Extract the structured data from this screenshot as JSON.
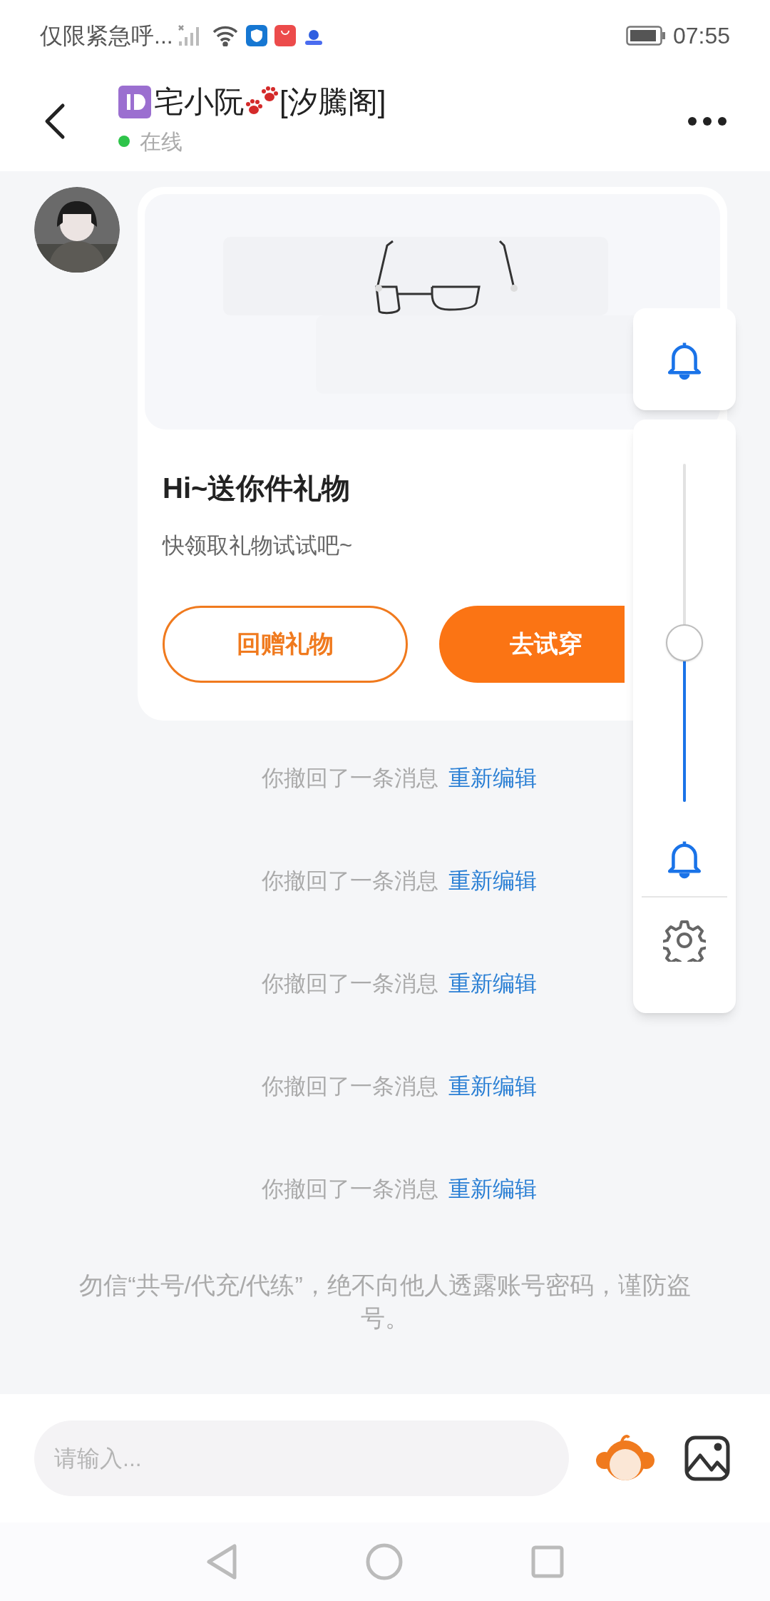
{
  "status_bar": {
    "carrier": "仅限紧急呼...",
    "time": "07:55"
  },
  "header": {
    "title": "宅小阮",
    "guild": "[汐騰阁]",
    "status": "在线",
    "online": true
  },
  "gift_card": {
    "title": "Hi~送你件礼物",
    "subtitle": "快领取礼物试试吧~",
    "buttons": [
      {
        "label": "回赠礼物",
        "kind": "outline"
      },
      {
        "label": "去试穿",
        "kind": "filled"
      }
    ]
  },
  "recalled": [
    {
      "text": "你撤回了一条消息",
      "action": "重新编辑"
    },
    {
      "text": "你撤回了一条消息",
      "action": "重新编辑"
    },
    {
      "text": "你撤回了一条消息",
      "action": "重新编辑"
    },
    {
      "text": "你撤回了一条消息",
      "action": "重新编辑"
    },
    {
      "text": "你撤回了一条消息",
      "action": "重新编辑"
    }
  ],
  "notice": "勿信“共号/代充/代练”，绝不向他人透露账号密码，谨防盗号。",
  "input": {
    "placeholder": "请输入..."
  },
  "volume_panel": {
    "level": 0.47
  }
}
